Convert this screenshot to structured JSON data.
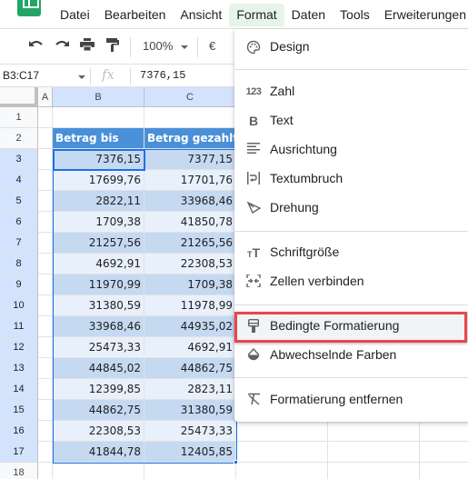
{
  "menubar": {
    "items": [
      "Datei",
      "Bearbeiten",
      "Ansicht",
      "Format",
      "Daten",
      "Tools",
      "Erweiterungen"
    ],
    "active_item": "Format"
  },
  "toolbar": {
    "zoom": "100%",
    "currency": "€",
    "icons": [
      "undo-icon",
      "redo-icon",
      "print-icon",
      "paint-format-icon"
    ]
  },
  "formula_bar": {
    "name_box": "B3:C17",
    "fx_label": "fx",
    "value": "7376,15"
  },
  "grid": {
    "column_headers": [
      "A",
      "B",
      "C"
    ],
    "row_numbers": [
      "1",
      "2",
      "3",
      "4",
      "5",
      "6",
      "7",
      "8",
      "9",
      "10",
      "11",
      "12",
      "13",
      "14",
      "15",
      "16",
      "17",
      "18"
    ],
    "selected_range": "B3:C17",
    "header_row": [
      "Betrag bis",
      "Betrag gezahlt"
    ],
    "rows": [
      [
        "7376,15",
        "7377,15"
      ],
      [
        "17699,76",
        "17701,76"
      ],
      [
        "2822,11",
        "33968,46"
      ],
      [
        "1709,38",
        "41850,78"
      ],
      [
        "21257,56",
        "21265,56"
      ],
      [
        "4692,91",
        "22308,53"
      ],
      [
        "11970,99",
        "1709,38"
      ],
      [
        "31380,59",
        "11978,99"
      ],
      [
        "33968,46",
        "44935,02"
      ],
      [
        "25473,33",
        "4692,91"
      ],
      [
        "44845,02",
        "44862,75"
      ],
      [
        "12399,85",
        "2823,11"
      ],
      [
        "44862,75",
        "31380,59"
      ],
      [
        "22308,53",
        "25473,33"
      ],
      [
        "41844,78",
        "12405,85"
      ]
    ],
    "colors": {
      "header_bg": "#4a90d9",
      "band_dark": "#c5d9f1",
      "band_light": "#e8f0fb",
      "selection": "#1a73e8"
    }
  },
  "format_menu": {
    "groups": [
      [
        {
          "label": "Design",
          "icon": "palette-icon"
        }
      ],
      [
        {
          "label": "Zahl",
          "icon": "number-format-icon"
        },
        {
          "label": "Text",
          "icon": "bold-icon"
        },
        {
          "label": "Ausrichtung",
          "icon": "align-icon"
        },
        {
          "label": "Textumbruch",
          "icon": "text-wrap-icon"
        },
        {
          "label": "Drehung",
          "icon": "text-rotation-icon"
        }
      ],
      [
        {
          "label": "Schriftgröße",
          "icon": "font-size-icon"
        },
        {
          "label": "Zellen verbinden",
          "icon": "merge-cells-icon"
        }
      ],
      [
        {
          "label": "Bedingte Formatierung",
          "icon": "conditional-format-icon",
          "highlighted": true
        },
        {
          "label": "Abwechselnde Farben",
          "icon": "alternating-colors-icon"
        }
      ],
      [
        {
          "label": "Formatierung entfernen",
          "icon": "clear-format-icon"
        }
      ]
    ],
    "highlight_color": "#e8474c"
  }
}
